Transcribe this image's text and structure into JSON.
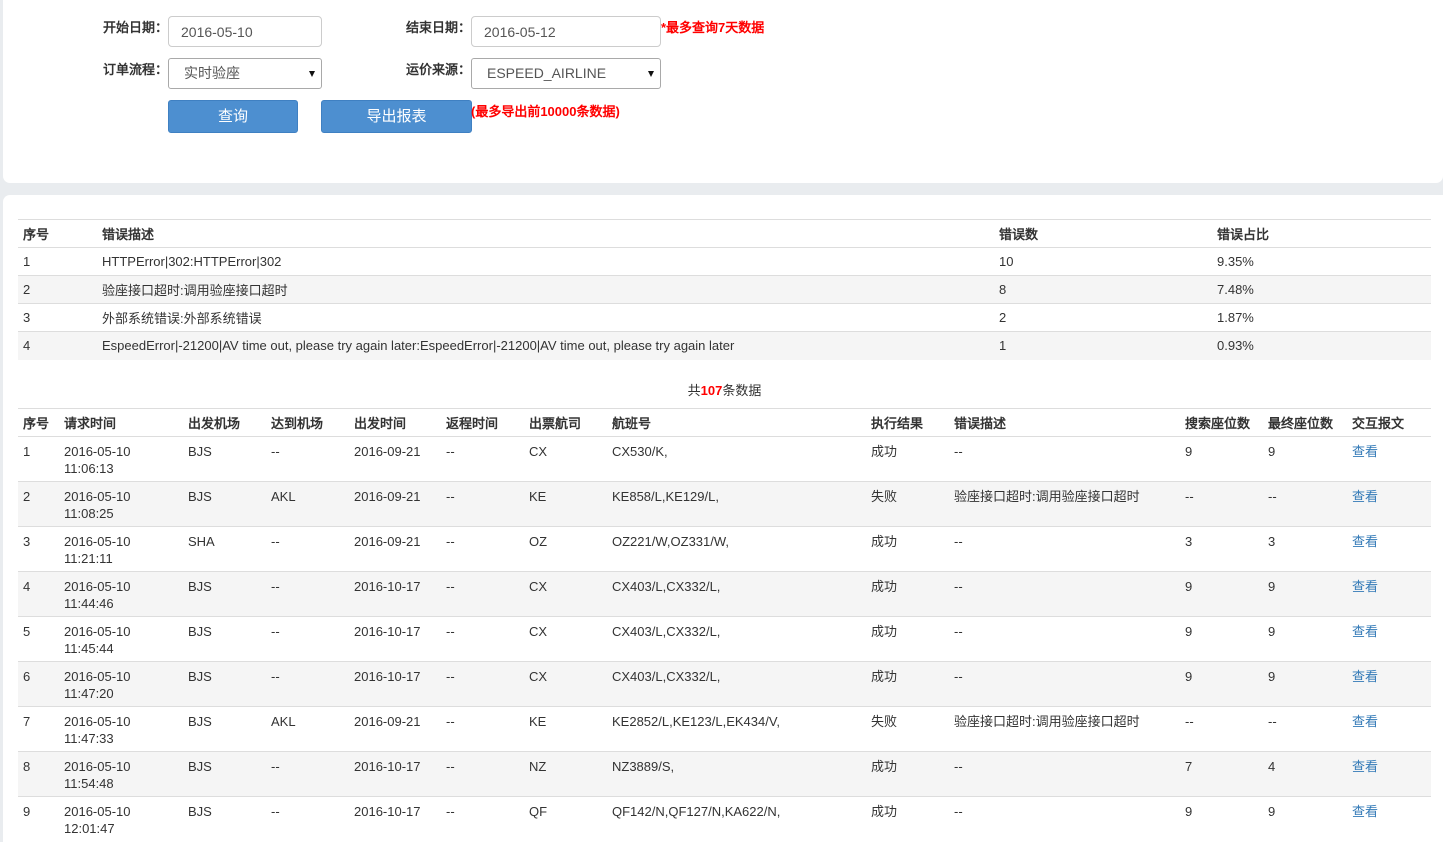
{
  "colors": {
    "page_background": "#e9ecef",
    "panel_background": "#ffffff",
    "accent_button": "#4d8fd0",
    "warning_text": "#ff0000",
    "link": "#337ab7",
    "stripe": "#f5f5f5",
    "border": "#dddddd"
  },
  "query_form": {
    "start_date": {
      "label": "开始日期：",
      "value": "2016-05-10"
    },
    "end_date": {
      "label": "结束日期：",
      "value": "2016-05-12"
    },
    "date_limit_note": "*最多查询7天数据",
    "order_flow": {
      "label": "订单流程：",
      "selected": "实时验座",
      "icon": "caret-down-icon"
    },
    "fare_source": {
      "label": "运价来源：",
      "selected": "ESPEED_AIRLINE",
      "icon": "caret-down-icon"
    },
    "query_button": "查询",
    "export_button": "导出报表",
    "export_limit_note": "(最多导出前10000条数据)"
  },
  "error_summary": {
    "columns": [
      "序号",
      "错误描述",
      "错误数",
      "错误占比"
    ],
    "rows": [
      {
        "no": "1",
        "description": "HTTPError|302:HTTPError|302",
        "count": "10",
        "ratio": "9.35%"
      },
      {
        "no": "2",
        "description": "验座接口超时:调用验座接口超时",
        "count": "8",
        "ratio": "7.48%"
      },
      {
        "no": "3",
        "description": "外部系统错误:外部系统错误",
        "count": "2",
        "ratio": "1.87%"
      },
      {
        "no": "4",
        "description": "EspeedError|-21200|AV time out, please try again later:EspeedError|-21200|AV time out, please try again later",
        "count": "1",
        "ratio": "0.93%"
      }
    ]
  },
  "total": {
    "prefix": "共",
    "count": "107",
    "suffix": "条数据"
  },
  "records": {
    "columns": [
      "序号",
      "请求时间",
      "出发机场",
      "达到机场",
      "出发时间",
      "返程时间",
      "出票航司",
      "航班号",
      "执行结果",
      "错误描述",
      "搜索座位数",
      "最终座位数",
      "交互报文"
    ],
    "view_label": "查看",
    "rows": [
      {
        "no": "1",
        "request_time": "2016-05-10 11:06:13",
        "departure_airport": "BJS",
        "arrival_airport": "--",
        "departure_date": "2016-09-21",
        "return_date": "--",
        "ticketing_airline": "CX",
        "flights": "CX530/K,",
        "result": "成功",
        "error": "--",
        "search_seats": "9",
        "final_seats": "9"
      },
      {
        "no": "2",
        "request_time": "2016-05-10 11:08:25",
        "departure_airport": "BJS",
        "arrival_airport": "AKL",
        "departure_date": "2016-09-21",
        "return_date": "--",
        "ticketing_airline": "KE",
        "flights": "KE858/L,KE129/L,",
        "result": "失败",
        "error": "验座接口超时:调用验座接口超时",
        "search_seats": "--",
        "final_seats": "--"
      },
      {
        "no": "3",
        "request_time": "2016-05-10 11:21:11",
        "departure_airport": "SHA",
        "arrival_airport": "--",
        "departure_date": "2016-09-21",
        "return_date": "--",
        "ticketing_airline": "OZ",
        "flights": "OZ221/W,OZ331/W,",
        "result": "成功",
        "error": "--",
        "search_seats": "3",
        "final_seats": "3"
      },
      {
        "no": "4",
        "request_time": "2016-05-10 11:44:46",
        "departure_airport": "BJS",
        "arrival_airport": "--",
        "departure_date": "2016-10-17",
        "return_date": "--",
        "ticketing_airline": "CX",
        "flights": "CX403/L,CX332/L,",
        "result": "成功",
        "error": "--",
        "search_seats": "9",
        "final_seats": "9"
      },
      {
        "no": "5",
        "request_time": "2016-05-10 11:45:44",
        "departure_airport": "BJS",
        "arrival_airport": "--",
        "departure_date": "2016-10-17",
        "return_date": "--",
        "ticketing_airline": "CX",
        "flights": "CX403/L,CX332/L,",
        "result": "成功",
        "error": "--",
        "search_seats": "9",
        "final_seats": "9"
      },
      {
        "no": "6",
        "request_time": "2016-05-10 11:47:20",
        "departure_airport": "BJS",
        "arrival_airport": "--",
        "departure_date": "2016-10-17",
        "return_date": "--",
        "ticketing_airline": "CX",
        "flights": "CX403/L,CX332/L,",
        "result": "成功",
        "error": "--",
        "search_seats": "9",
        "final_seats": "9"
      },
      {
        "no": "7",
        "request_time": "2016-05-10 11:47:33",
        "departure_airport": "BJS",
        "arrival_airport": "AKL",
        "departure_date": "2016-09-21",
        "return_date": "--",
        "ticketing_airline": "KE",
        "flights": "KE2852/L,KE123/L,EK434/V,",
        "result": "失败",
        "error": "验座接口超时:调用验座接口超时",
        "search_seats": "--",
        "final_seats": "--"
      },
      {
        "no": "8",
        "request_time": "2016-05-10 11:54:48",
        "departure_airport": "BJS",
        "arrival_airport": "--",
        "departure_date": "2016-10-17",
        "return_date": "--",
        "ticketing_airline": "NZ",
        "flights": "NZ3889/S,",
        "result": "成功",
        "error": "--",
        "search_seats": "7",
        "final_seats": "4"
      },
      {
        "no": "9",
        "request_time": "2016-05-10 12:01:47",
        "departure_airport": "BJS",
        "arrival_airport": "--",
        "departure_date": "2016-10-17",
        "return_date": "--",
        "ticketing_airline": "QF",
        "flights": "QF142/N,QF127/N,KA622/N,",
        "result": "成功",
        "error": "--",
        "search_seats": "9",
        "final_seats": "9"
      }
    ]
  }
}
